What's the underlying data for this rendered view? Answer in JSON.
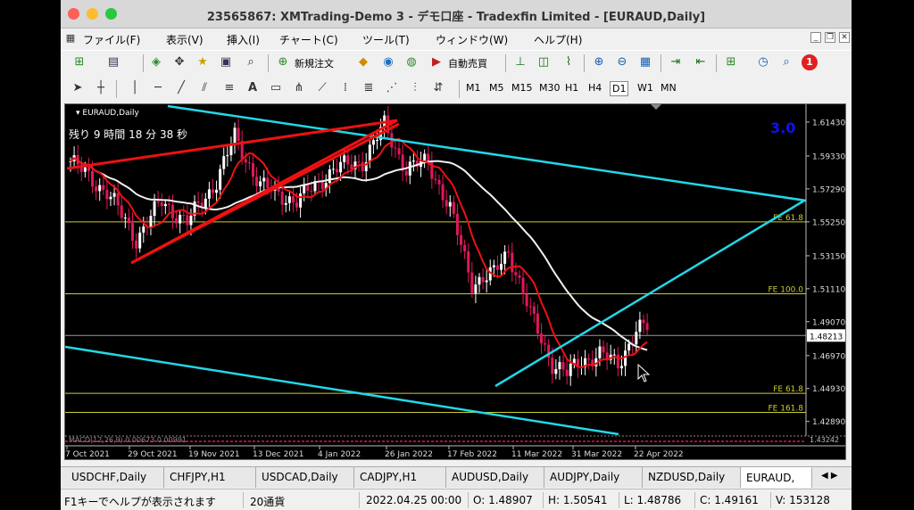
{
  "window": {
    "title": "23565867: XMTrading-Demo 3 - デモ口座 - Tradexfin Limited - [EURAUD,Daily]"
  },
  "menu": [
    "ファイル(F)",
    "表示(V)",
    "挿入(I)",
    "チャート(C)",
    "ツール(T)",
    "ウィンドウ(W)",
    "ヘルプ(H)"
  ],
  "toolbar": {
    "new_order": "新規注文",
    "auto_trade": "自動売買",
    "notification_count": "1"
  },
  "drawing_toolbar": {
    "text_tool": "A",
    "timeframes": [
      "M1",
      "M5",
      "M15",
      "M30",
      "H1",
      "H4",
      "D1",
      "W1",
      "MN"
    ],
    "active_timeframe": "D1"
  },
  "chart": {
    "symbol_label": "EURAUD,Daily",
    "countdown": "残り 9 時間 18 分 38 秒",
    "indicator_value": "3.0",
    "current_price": "1.48213",
    "indicator_bar_text": "MACD(12,26,9) 0.00673 0.00991",
    "indicator_bar_scale": "1.43242",
    "price_ticks": [
      "1.61430",
      "1.59330",
      "1.57290",
      "1.55250",
      "1.53150",
      "1.51110",
      "1.49070",
      "1.46970",
      "1.44930",
      "1.42890"
    ],
    "date_ticks": [
      "7 Oct 2021",
      "29 Oct 2021",
      "19 Nov 2021",
      "13 Dec 2021",
      "4 Jan 2022",
      "26 Jan 2022",
      "17 Feb 2022",
      "11 Mar 2022",
      "31 Mar 2022",
      "22 Apr 2022"
    ],
    "fibo_labels": [
      "FE 61.8",
      "FE 100.0",
      "FE 61.8",
      "FE 161.8"
    ]
  },
  "tabs": [
    "USDCHF,Daily",
    "CHFJPY,H1",
    "USDCAD,Daily",
    "CADJPY,H1",
    "AUDUSD,Daily",
    "AUDJPY,Daily",
    "NZDUSD,Daily",
    "EURAUD,"
  ],
  "active_tab": "EURAUD,",
  "status": {
    "help": "F1キーでヘルプが表示されます",
    "profile": "20通貨",
    "datetime": "2022.04.25 00:00",
    "open": "O: 1.48907",
    "high": "H: 1.50541",
    "low": "L: 1.48786",
    "close": "C: 1.49161",
    "volume": "V: 153128"
  },
  "colors": {
    "up_candle": "#ffffff",
    "down_candle": "#e0185a",
    "ma_fast": "#ee1111",
    "ma_slow": "#f0f0f0",
    "trendline_cyan": "#22d8e8",
    "trendline_red": "#ee1111",
    "fibo": "#cccc33",
    "indicator_text": "#1111ee"
  }
}
